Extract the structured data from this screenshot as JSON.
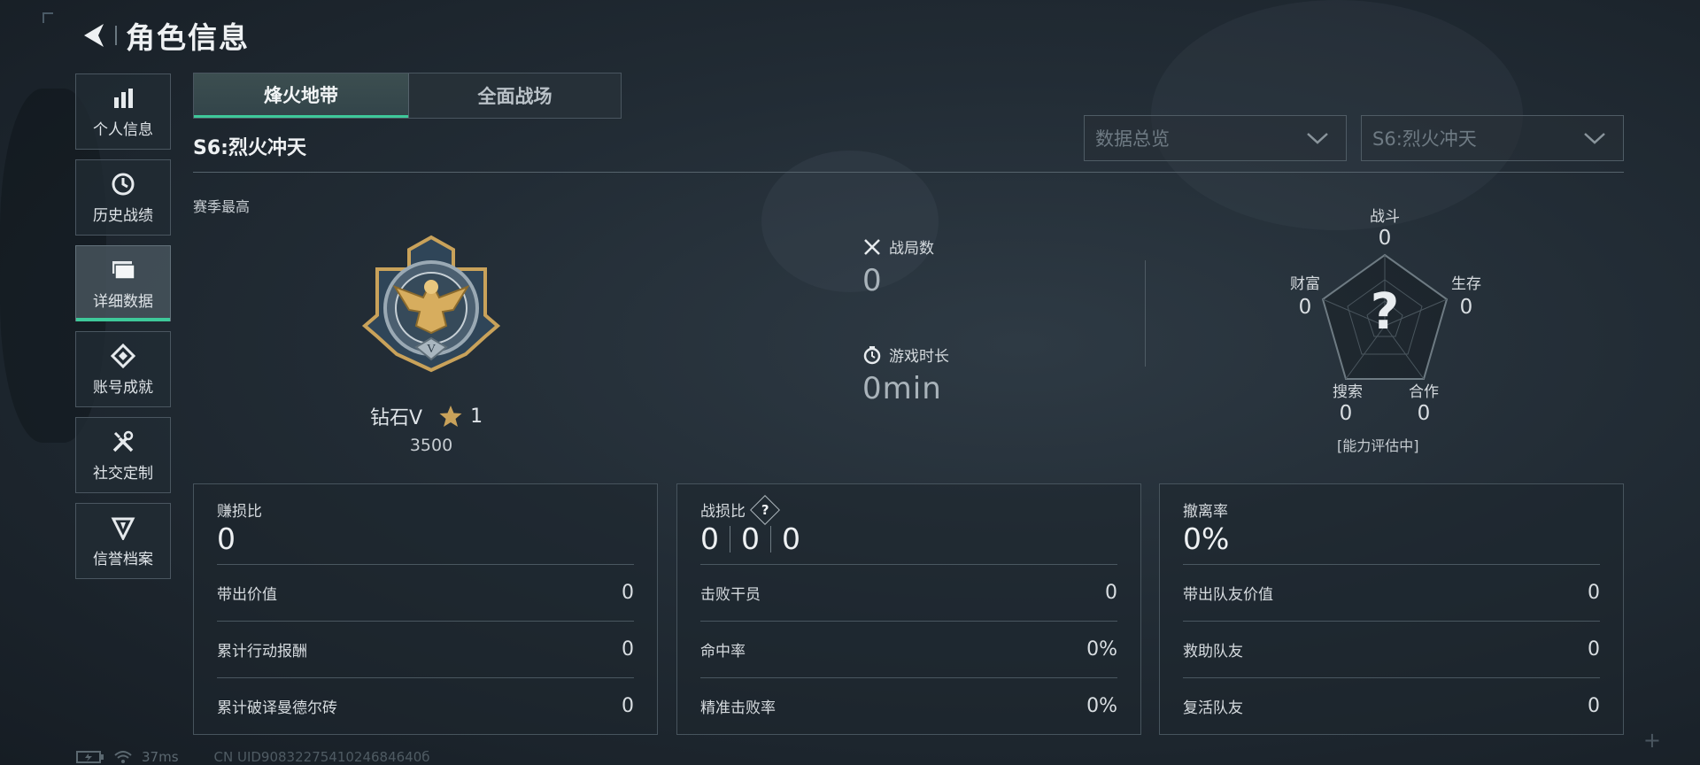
{
  "header": {
    "title": "角色信息"
  },
  "sidebar": {
    "items": [
      {
        "label": "个人信息",
        "icon": "bar-chart-icon"
      },
      {
        "label": "历史战绩",
        "icon": "clock-history-icon"
      },
      {
        "label": "详细数据",
        "icon": "folder-icon",
        "active": true
      },
      {
        "label": "账号成就",
        "icon": "achievement-icon"
      },
      {
        "label": "社交定制",
        "icon": "tools-icon"
      },
      {
        "label": "信誉档案",
        "icon": "shield-badge-icon"
      }
    ]
  },
  "tabs": [
    {
      "label": "烽火地带",
      "active": true
    },
    {
      "label": "全面战场",
      "active": false
    }
  ],
  "season": {
    "title": "S6:烈火冲天"
  },
  "filters": {
    "data_scope": "数据总览",
    "season_select": "S6:烈火冲天"
  },
  "season_best": {
    "label": "赛季最高",
    "rank_name": "钻石V",
    "stars": "1",
    "score": "3500"
  },
  "stats": {
    "matches_label": "战局数",
    "matches_value": "0",
    "playtime_label": "游戏时长",
    "playtime_value": "0min"
  },
  "ability": {
    "combat_label": "战斗",
    "combat_value": "0",
    "survival_label": "生存",
    "survival_value": "0",
    "coop_label": "合作",
    "coop_value": "0",
    "search_label": "搜索",
    "search_value": "0",
    "wealth_label": "财富",
    "wealth_value": "0",
    "center_mark": "?",
    "note": "[能力评估中]"
  },
  "panels": {
    "profit": {
      "title": "赚损比",
      "value": "0",
      "rows": [
        {
          "label": "带出价值",
          "value": "0"
        },
        {
          "label": "累计行动报酬",
          "value": "0"
        },
        {
          "label": "累计破译曼德尔砖",
          "value": "0"
        }
      ]
    },
    "combat": {
      "title": "战损比",
      "help": "?",
      "values": [
        "0",
        "0",
        "0"
      ],
      "rows": [
        {
          "label": "击败干员",
          "value": "0"
        },
        {
          "label": "命中率",
          "value": "0%"
        },
        {
          "label": "精准击败率",
          "value": "0%"
        }
      ]
    },
    "extract": {
      "title": "撤离率",
      "value": "0%",
      "rows": [
        {
          "label": "带出队友价值",
          "value": "0"
        },
        {
          "label": "救助队友",
          "value": "0"
        },
        {
          "label": "复活队友",
          "value": "0"
        }
      ]
    }
  },
  "footer": {
    "latency": "37ms",
    "uid": "CN UID9083227541024684640б"
  },
  "colors": {
    "accent": "#3ec99a",
    "gold": "#c9a25a",
    "background": "#222c35"
  }
}
